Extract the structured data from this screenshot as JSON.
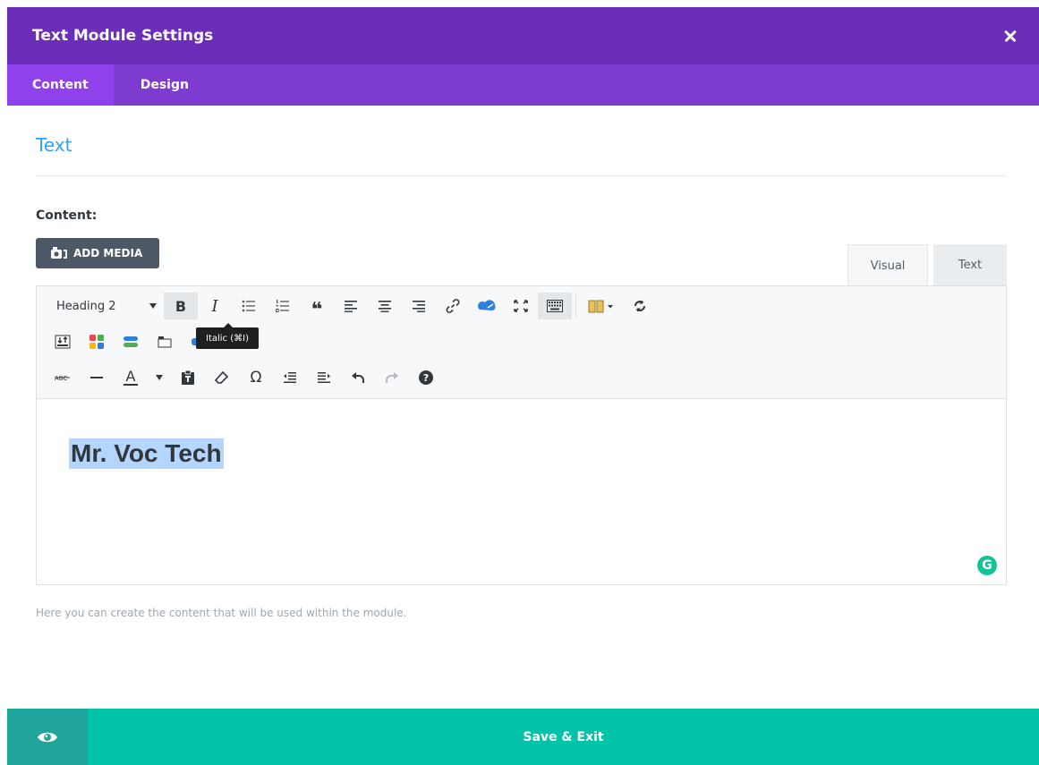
{
  "modal": {
    "title": "Text Module Settings"
  },
  "tabs": [
    {
      "label": "Content",
      "active": true
    },
    {
      "label": "Design",
      "active": false
    }
  ],
  "section": {
    "title": "Text"
  },
  "content_field": {
    "label": "Content:",
    "add_media_label": "ADD MEDIA",
    "mode_tabs": [
      {
        "label": "Visual",
        "active": true
      },
      {
        "label": "Text",
        "active": false
      }
    ],
    "format_select": "Heading 2",
    "tooltip": "Italic (⌘I)",
    "editor_text": "Mr. Voc Tech",
    "help_text": "Here you can create the content that will be used within the module."
  },
  "footer": {
    "save_label": "Save & Exit"
  },
  "icons": {
    "bold": "B",
    "italic": "I",
    "blockquote": "❝",
    "special_char": "Ω",
    "text_color": "A",
    "help": "?",
    "grammarly": "G"
  },
  "colors": {
    "header": "#6c2eb9",
    "tabs_bar": "#7e3bd0",
    "tab_active": "#8f42ec",
    "accent_blue": "#2ea3f2",
    "save": "#00c3aa",
    "preview": "#1fa59a",
    "selection": "#b4d5fe"
  }
}
